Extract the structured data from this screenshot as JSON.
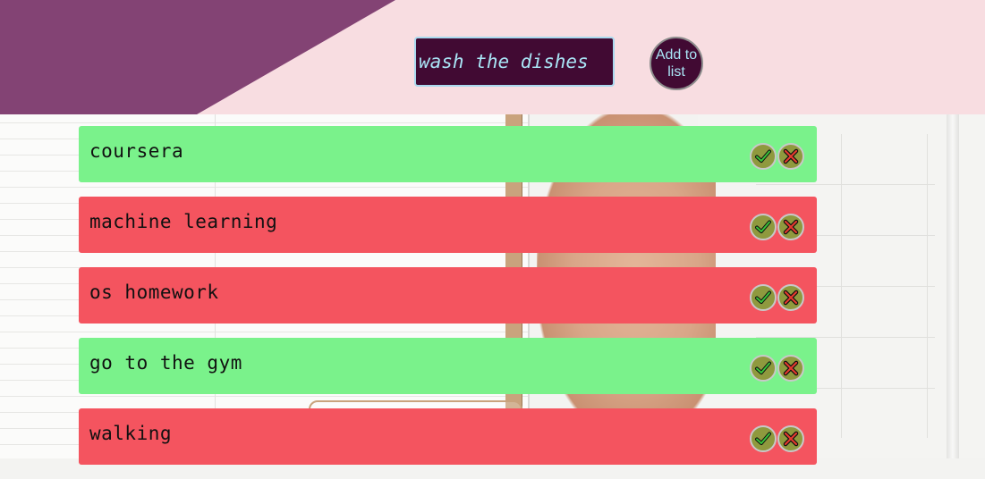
{
  "header": {
    "input_value": "wash the dishes",
    "add_button_label": "Add to list"
  },
  "colors": {
    "header_bg": "#f8dde1",
    "accent_purple": "#834374",
    "input_bg": "#410a33",
    "input_text": "#a9e5f6",
    "done_bg": "#7af28b",
    "pending_bg": "#f4545f",
    "action_button_bg": "#8f993e"
  },
  "tasks": [
    {
      "label": "coursera",
      "status": "done"
    },
    {
      "label": "machine learning",
      "status": "pending"
    },
    {
      "label": "os homework",
      "status": "pending"
    },
    {
      "label": "go to the gym",
      "status": "done"
    },
    {
      "label": "walking",
      "status": "pending"
    }
  ],
  "icons": {
    "complete": "check-icon",
    "delete": "cross-icon"
  }
}
